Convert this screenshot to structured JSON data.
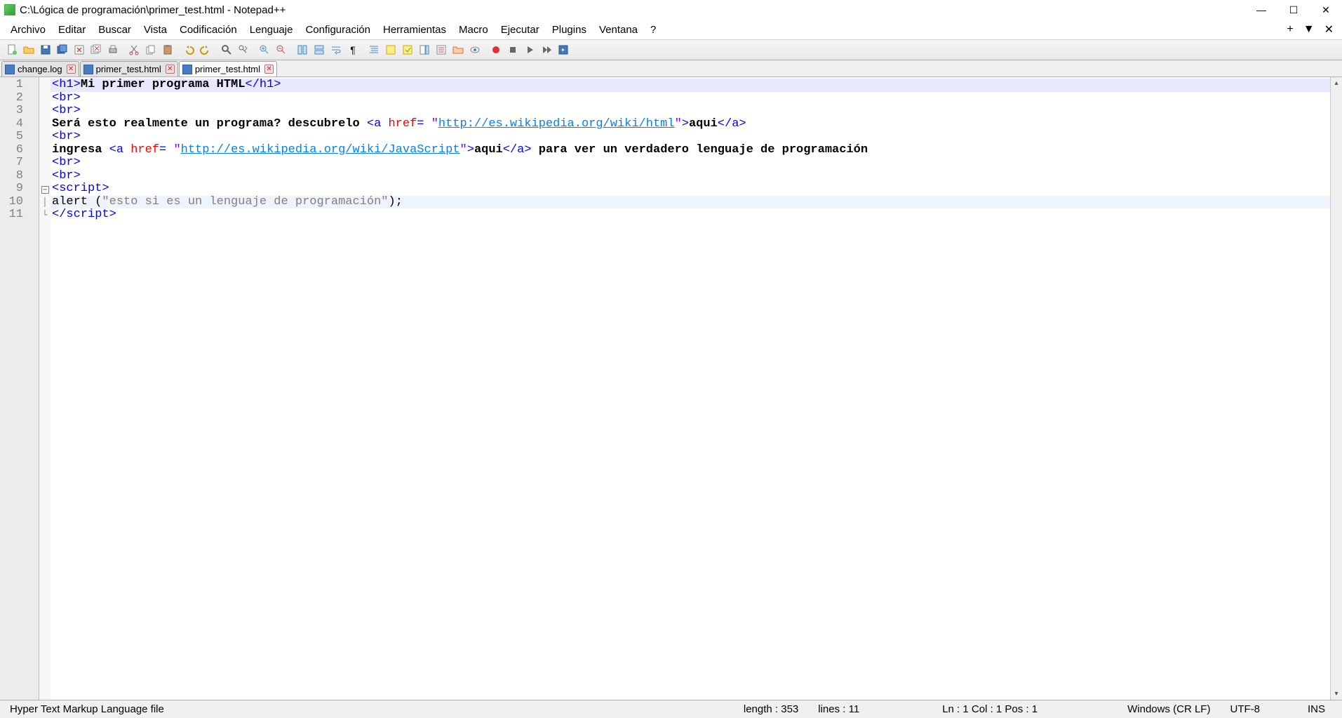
{
  "window": {
    "title": "C:\\Lógica de programación\\primer_test.html - Notepad++"
  },
  "menu": {
    "items": [
      "Archivo",
      "Editar",
      "Buscar",
      "Vista",
      "Codificación",
      "Lenguaje",
      "Configuración",
      "Herramientas",
      "Macro",
      "Ejecutar",
      "Plugins",
      "Ventana",
      "?"
    ]
  },
  "menu_right": {
    "plus": "+",
    "down": "▼",
    "close": "✕"
  },
  "toolbar_icons": [
    "new",
    "open",
    "save",
    "save-all",
    "close",
    "close-all",
    "print",
    "",
    "cut",
    "copy",
    "paste",
    "",
    "undo",
    "redo",
    "",
    "find",
    "replace",
    "",
    "zoom-in",
    "zoom-out",
    "",
    "sync-v",
    "sync-h",
    "wrap",
    "",
    "show-all",
    "indent-guide",
    "lang",
    "udl",
    "doc-map",
    "func-list",
    "folder",
    "monitor",
    "",
    "record",
    "stop",
    "play",
    "play-multi",
    "save-macro"
  ],
  "tabs": [
    {
      "label": "change.log",
      "active": false,
      "dirty": false
    },
    {
      "label": "primer_test.html",
      "active": false,
      "dirty": false
    },
    {
      "label": "primer_test.html",
      "active": true,
      "dirty": false
    }
  ],
  "code": {
    "lines": [
      {
        "n": 1,
        "hl": "first",
        "tokens": [
          {
            "t": "<",
            "c": "tag"
          },
          {
            "t": "h1",
            "c": "tag"
          },
          {
            "t": ">",
            "c": "tag"
          },
          {
            "t": "Mi primer programa HTML",
            "c": "txt-b"
          },
          {
            "t": "</",
            "c": "tag"
          },
          {
            "t": "h1",
            "c": "tag"
          },
          {
            "t": ">",
            "c": "tag"
          }
        ]
      },
      {
        "n": 2,
        "tokens": [
          {
            "t": "<",
            "c": "tag"
          },
          {
            "t": "br",
            "c": "tag"
          },
          {
            "t": ">",
            "c": "tag"
          }
        ]
      },
      {
        "n": 3,
        "tokens": [
          {
            "t": "<",
            "c": "tag"
          },
          {
            "t": "br",
            "c": "tag"
          },
          {
            "t": ">",
            "c": "tag"
          }
        ]
      },
      {
        "n": 4,
        "tokens": [
          {
            "t": "Será esto realmente un programa? descubrelo ",
            "c": "txt-b"
          },
          {
            "t": "<",
            "c": "tag"
          },
          {
            "t": "a ",
            "c": "tag"
          },
          {
            "t": "href",
            "c": "attr"
          },
          {
            "t": "= ",
            "c": "tag"
          },
          {
            "t": "\"",
            "c": "val-q"
          },
          {
            "t": "http://es.wikipedia.org/wiki/html",
            "c": "url"
          },
          {
            "t": "\"",
            "c": "val-q"
          },
          {
            "t": ">",
            "c": "tag"
          },
          {
            "t": "aqui",
            "c": "txt-b"
          },
          {
            "t": "</",
            "c": "tag"
          },
          {
            "t": "a",
            "c": "tag"
          },
          {
            "t": ">",
            "c": "tag"
          }
        ]
      },
      {
        "n": 5,
        "tokens": [
          {
            "t": "<",
            "c": "tag"
          },
          {
            "t": "br",
            "c": "tag"
          },
          {
            "t": ">",
            "c": "tag"
          }
        ]
      },
      {
        "n": 6,
        "tokens": [
          {
            "t": "ingresa ",
            "c": "txt-b"
          },
          {
            "t": "<",
            "c": "tag"
          },
          {
            "t": "a ",
            "c": "tag"
          },
          {
            "t": "href",
            "c": "attr"
          },
          {
            "t": "= ",
            "c": "tag"
          },
          {
            "t": "\"",
            "c": "val-q"
          },
          {
            "t": "http://es.wikipedia.org/wiki/JavaScript",
            "c": "url"
          },
          {
            "t": "\"",
            "c": "val-q"
          },
          {
            "t": ">",
            "c": "tag"
          },
          {
            "t": "aqui",
            "c": "txt-b"
          },
          {
            "t": "</",
            "c": "tag"
          },
          {
            "t": "a",
            "c": "tag"
          },
          {
            "t": ">",
            "c": "tag"
          },
          {
            "t": " para ver un verdadero lenguaje de programación",
            "c": "txt-b"
          }
        ]
      },
      {
        "n": 7,
        "tokens": [
          {
            "t": "<",
            "c": "tag"
          },
          {
            "t": "br",
            "c": "tag"
          },
          {
            "t": ">",
            "c": "tag"
          }
        ]
      },
      {
        "n": 8,
        "tokens": [
          {
            "t": "<",
            "c": "tag"
          },
          {
            "t": "br",
            "c": "tag"
          },
          {
            "t": ">",
            "c": "tag"
          }
        ]
      },
      {
        "n": 9,
        "fold": "start",
        "tokens": [
          {
            "t": "<",
            "c": "tag"
          },
          {
            "t": "script",
            "c": "tag"
          },
          {
            "t": ">",
            "c": "tag"
          }
        ]
      },
      {
        "n": 10,
        "hl": "cur",
        "tokens": [
          {
            "t": "alert ",
            "c": ""
          },
          {
            "t": "(",
            "c": ""
          },
          {
            "t": "\"esto si es un lenguaje de programación\"",
            "c": "str"
          },
          {
            "t": ")",
            "c": ""
          },
          {
            "t": ";",
            "c": ""
          }
        ]
      },
      {
        "n": 11,
        "fold": "end",
        "tokens": [
          {
            "t": "</",
            "c": "tag"
          },
          {
            "t": "script",
            "c": "tag"
          },
          {
            "t": ">",
            "c": "tag"
          }
        ]
      }
    ]
  },
  "status": {
    "file_type": "Hyper Text Markup Language file",
    "length": "length : 353",
    "lines": "lines : 11",
    "pos": "Ln : 1   Col : 1   Pos : 1",
    "eol": "Windows (CR LF)",
    "encoding": "UTF-8",
    "ins": "INS"
  }
}
